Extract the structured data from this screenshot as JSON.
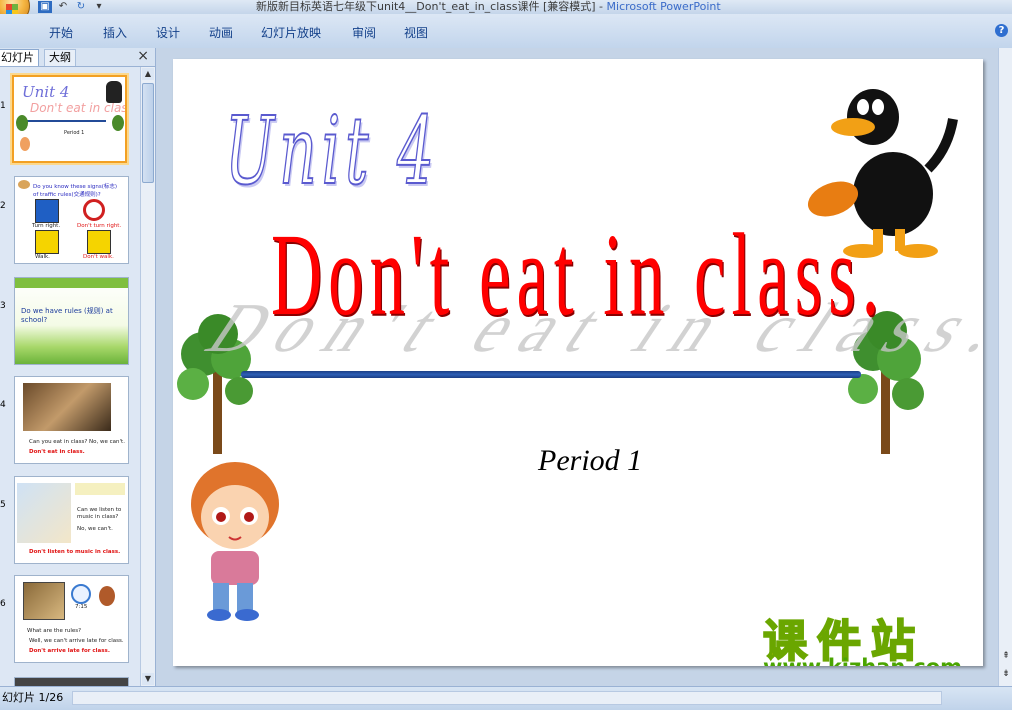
{
  "window": {
    "title": "新版新目标英语七年级下unit4__Don't_eat_in_class课件 [兼容模式] - ",
    "app_name": "Microsoft PowerPoint"
  },
  "qat": {
    "save": "save-icon",
    "undo": "undo-icon",
    "redo": "redo-icon"
  },
  "ribbon": {
    "tabs": [
      "开始",
      "插入",
      "设计",
      "动画",
      "幻灯片放映",
      "审阅",
      "视图"
    ]
  },
  "panel": {
    "tab_slides": "幻灯片",
    "tab_outline": "大纲",
    "close_glyph": "×"
  },
  "thumbnails": [
    {
      "num": "1",
      "title": "Unit 4",
      "subtitle": "Don't eat in class",
      "caption": "Period 1"
    },
    {
      "num": "2",
      "line1": "Do you know these signs(标志)",
      "line2": "of traffic rules(交通规则)?",
      "cap1": "Turn right.",
      "cap2": "Don't turn right.",
      "cap3": "Walk.",
      "cap4": "Don't walk."
    },
    {
      "num": "3",
      "line1": "Do we have rules (规则) at",
      "line2": "school?"
    },
    {
      "num": "4",
      "line1": "Can you eat in class? No, we can't.",
      "line2": "Don't eat in class."
    },
    {
      "num": "5",
      "line1": "Can we listen to",
      "line2": "music in class?",
      "line3": "No, we can't.",
      "line4": "Don't listen to music in class."
    },
    {
      "num": "6",
      "time": "7:15",
      "line1": "What are the rules?",
      "line2": "Well, we can't arrive late for class.",
      "line3": "Don't arrive late for class."
    }
  ],
  "slide": {
    "unit": "Unit 4",
    "title": "Don't eat in class.",
    "period": "Period 1",
    "watermark_cn": "课件站",
    "watermark_url": "www.kjzhan.com"
  },
  "status": {
    "slide_info": "幻灯片 1/26"
  },
  "colors": {
    "accent": "#15428b",
    "selection": "#f2a024",
    "title_red": "#ff0000"
  }
}
